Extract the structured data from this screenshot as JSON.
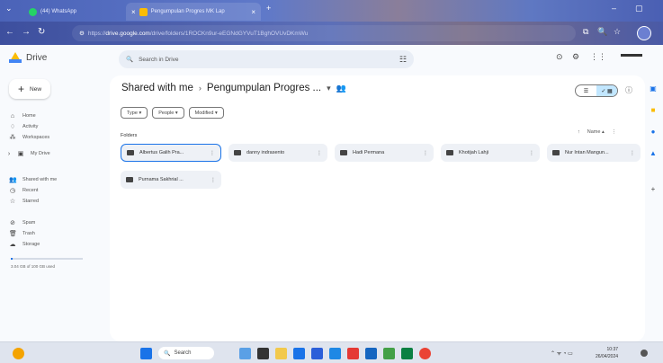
{
  "browser": {
    "tabs": [
      {
        "title": "(44) WhatsApp",
        "color": "#25d366"
      },
      {
        "title": "Pengumpulan Progres MK Lap",
        "color": "#fbbc04"
      }
    ],
    "new_tab": "+",
    "url_prefix": "https://",
    "url_host": "drive.google.com",
    "url_path": "/drive/folders/1ROCKn9ur-eEGNdGYVuT1BghOVUvDKmWu"
  },
  "app": {
    "name": "Drive",
    "search_placeholder": "Search in Drive",
    "new_label": "New",
    "sidebar": [
      {
        "label": "Home",
        "icon": "⌂"
      },
      {
        "label": "Activity",
        "icon": "♢"
      },
      {
        "label": "Workspaces",
        "icon": "⁂"
      },
      {
        "label": "My Drive",
        "icon": "▣"
      },
      {
        "label": "Shared with me",
        "icon": "👥"
      },
      {
        "label": "Recent",
        "icon": "◷"
      },
      {
        "label": "Starred",
        "icon": "☆"
      },
      {
        "label": "Spam",
        "icon": "⊘"
      },
      {
        "label": "Trash",
        "icon": "🗑"
      },
      {
        "label": "Storage",
        "icon": "☁"
      }
    ],
    "storage_text": "3.04 GB of 100 GB used",
    "storage_fraction": 0.03
  },
  "main": {
    "crumb_root": "Shared with me",
    "crumb_current": "Pengumpulan Progres ...",
    "filters": [
      "Type ▾",
      "People ▾",
      "Modified ▾"
    ],
    "folders_label": "Folders",
    "sort_label": "Name ▴",
    "folders": [
      "Albertus Galih Pra...",
      "danny indrasento",
      "Hadi Permana",
      "Khotijah Lahji",
      "Nur Intan Mangun...",
      "Purnama Sakhrial ..."
    ]
  },
  "taskbar": {
    "search_label": "Search",
    "time": "10:37",
    "date": "26/04/2024"
  }
}
